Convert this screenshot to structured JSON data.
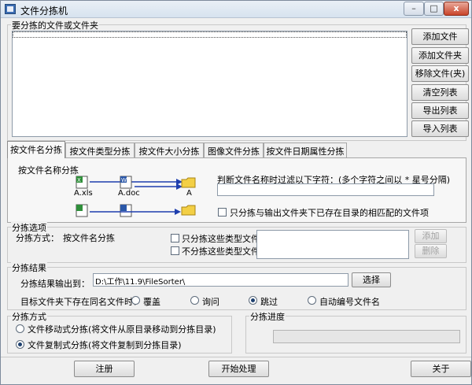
{
  "window": {
    "title": "文件分拣机",
    "minimize": "–",
    "maximize": "□",
    "close": "x"
  },
  "file_list": {
    "group_label": "要分拣的文件或文件夹",
    "buttons": {
      "add_file": "添加文件",
      "add_folder": "添加文件夹",
      "remove": "移除文件(夹)",
      "clear": "清空列表",
      "export": "导出列表",
      "import": "导入列表"
    }
  },
  "tabs": [
    {
      "label": "按文件名分拣"
    },
    {
      "label": "按文件类型分拣"
    },
    {
      "label": "按文件大小分拣"
    },
    {
      "label": "图像文件分拣"
    },
    {
      "label": "按文件日期属性分拣"
    }
  ],
  "tab_panel": {
    "heading": "按文件名称分拣",
    "illustration": {
      "file1": "A.xls",
      "file2": "A.doc",
      "folder": "A"
    },
    "filter_label": "判断文件名称时过滤以下字符：(多个字符之间以 * 星号分隔)",
    "filter_value": "",
    "existing_only_label": "只分拣与输出文件夹下已存在目录的相匹配的文件项"
  },
  "sort_options": {
    "group_label": "分拣选项",
    "method_label": "分拣方式：",
    "method_value": "按文件名分拣",
    "only_types_label": "只分拣这些类型文件：",
    "exclude_types_label": "不分拣这些类型文件：",
    "add_label": "添加",
    "delete_label": "删除"
  },
  "result": {
    "group_label": "分拣结果",
    "output_label": "分拣结果输出到：",
    "output_path": "D:\\工作\\11.9\\FileSorter\\",
    "select_label": "选择",
    "conflict_label": "目标文件夹下存在同名文件时：",
    "options": [
      {
        "label": "覆盖",
        "selected": false
      },
      {
        "label": "询问",
        "selected": false
      },
      {
        "label": "跳过",
        "selected": true
      },
      {
        "label": "自动编号文件名",
        "selected": false
      }
    ]
  },
  "mode": {
    "group_label": "分拣方式",
    "move_label": "文件移动式分拣(将文件从原目录移动到分拣目录)",
    "copy_label": "文件复制式分拣(将文件复制到分拣目录)",
    "selected": "copy"
  },
  "progress": {
    "group_label": "分拣进度",
    "value": 0
  },
  "footer": {
    "register": "注册",
    "start": "开始处理",
    "about": "关于"
  },
  "colors": {
    "arrow": "#1f3fae",
    "folder": "#f3cf45",
    "excel": "#2f8f3a",
    "doc": "#2a57a8"
  }
}
